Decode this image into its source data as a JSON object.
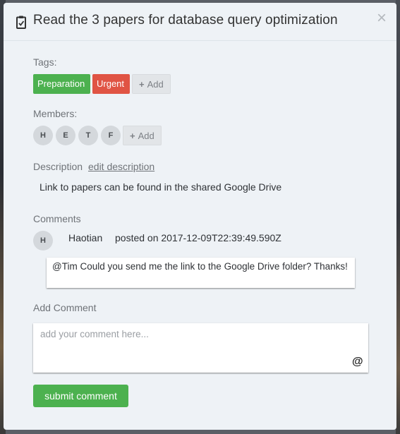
{
  "modal": {
    "title": "Read the 3 papers for database query optimization",
    "close_label": "×"
  },
  "tags": {
    "label": "Tags:",
    "items": [
      {
        "label": "Preparation",
        "color": "#4cb14f"
      },
      {
        "label": "Urgent",
        "color": "#e05444"
      }
    ],
    "add_label": "Add"
  },
  "members": {
    "label": "Members:",
    "items": [
      "H",
      "E",
      "T",
      "F"
    ],
    "add_label": "Add"
  },
  "description": {
    "label": "Description",
    "edit_label": "edit description",
    "text": "Link to papers can be found in the shared Google Drive"
  },
  "comments": {
    "label": "Comments",
    "items": [
      {
        "avatar": "H",
        "author": "Haotian",
        "posted": "posted on 2017-12-09T22:39:49.590Z",
        "text": "@Tim  Could you send me the link to the Google Drive folder? Thanks!"
      }
    ]
  },
  "add_comment": {
    "label": "Add Comment",
    "placeholder": "add your comment here...",
    "mention_label": "@",
    "submit_label": "submit comment"
  },
  "icons": {
    "title_icon": "clipboard-check-icon",
    "add_icon": "plus-icon"
  },
  "colors": {
    "accent_green": "#4cb14f",
    "urgent_red": "#e05444",
    "modal_bg": "#eef2f6"
  }
}
